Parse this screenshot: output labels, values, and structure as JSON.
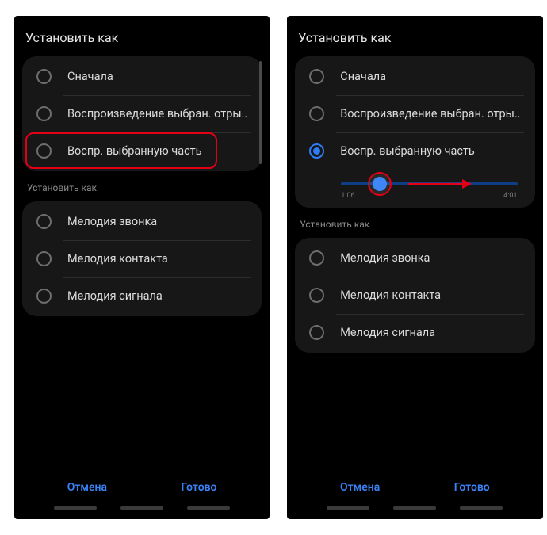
{
  "title": "Установить как",
  "playback": {
    "options": [
      {
        "label": "Сначала"
      },
      {
        "label": "Воспроизведение выбран. отры.."
      },
      {
        "label": "Воспр. выбранную часть"
      }
    ]
  },
  "subheader": "Установить как",
  "setas": {
    "options": [
      {
        "label": "Мелодия звонка"
      },
      {
        "label": "Мелодия контакта"
      },
      {
        "label": "Мелодия сигнала"
      }
    ]
  },
  "slider": {
    "start": "1:06",
    "end": "4:01"
  },
  "footer": {
    "cancel": "Отмена",
    "done": "Готово"
  }
}
